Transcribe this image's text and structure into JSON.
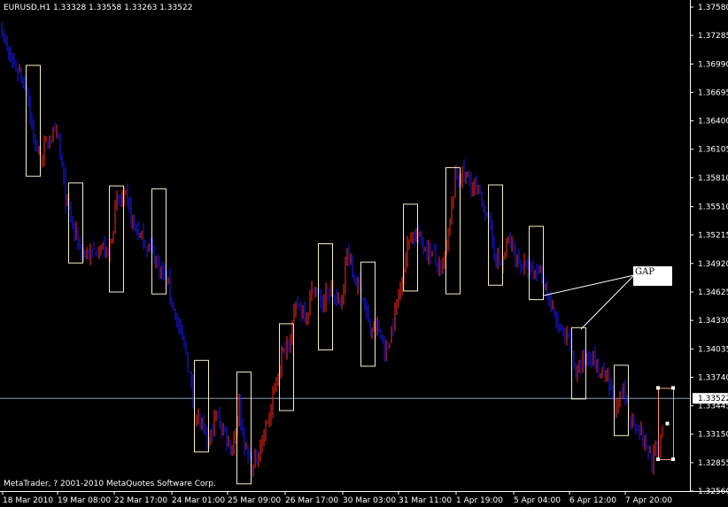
{
  "chart_data": {
    "type": "candlestick",
    "symbol_info": "EURUSD,H1  1.33328 1.33558 1.33263 1.33522",
    "symbol": "EURUSD",
    "timeframe": "H1",
    "last_bar": {
      "open": 1.33328,
      "high": 1.33558,
      "low": 1.33263,
      "close": 1.33522
    },
    "current_price": 1.33522,
    "current_price_label": "1.33522",
    "ylim": [
      1.3256,
      1.3758
    ],
    "y_ticks": [
      1.3758,
      1.37285,
      1.3699,
      1.36695,
      1.364,
      1.36105,
      1.3581,
      1.3551,
      1.35215,
      1.3492,
      1.34625,
      1.3433,
      1.34035,
      1.3374,
      1.33445,
      1.3315,
      1.32855,
      1.3256
    ],
    "y_tick_labels": [
      "1.37580",
      "1.37285",
      "1.36990",
      "1.36695",
      "1.36400",
      "1.36105",
      "1.35810",
      "1.35510",
      "1.35215",
      "1.34920",
      "1.34625",
      "1.34330",
      "1.34035",
      "1.33740",
      "1.33445",
      "1.33150",
      "1.32855",
      "1.32560"
    ],
    "x_tick_labels": [
      "18 Mar 2010",
      "19 Mar 08:00",
      "22 Mar 17:00",
      "24 Mar 01:00",
      "25 Mar 09:00",
      "26 Mar 17:00",
      "30 Mar 03:00",
      "31 Mar 11:00",
      "1 Apr 19:00",
      "5 Apr 04:00",
      "6 Apr 12:00",
      "7 Apr 20:00"
    ],
    "path": [
      [
        0,
        1.3745
      ],
      [
        10,
        1.3705
      ],
      [
        22,
        1.369
      ],
      [
        30,
        1.3675
      ],
      [
        38,
        1.362
      ],
      [
        46,
        1.36
      ],
      [
        56,
        1.3625
      ],
      [
        66,
        1.362
      ],
      [
        74,
        1.356
      ],
      [
        84,
        1.3525
      ],
      [
        92,
        1.3505
      ],
      [
        102,
        1.35
      ],
      [
        112,
        1.351
      ],
      [
        122,
        1.35
      ],
      [
        132,
        1.3555
      ],
      [
        142,
        1.356
      ],
      [
        150,
        1.3535
      ],
      [
        158,
        1.352
      ],
      [
        168,
        1.351
      ],
      [
        180,
        1.349
      ],
      [
        190,
        1.347
      ],
      [
        200,
        1.343
      ],
      [
        210,
        1.34
      ],
      [
        220,
        1.334
      ],
      [
        228,
        1.332
      ],
      [
        236,
        1.3305
      ],
      [
        244,
        1.3335
      ],
      [
        252,
        1.332
      ],
      [
        262,
        1.33
      ],
      [
        270,
        1.3345
      ],
      [
        278,
        1.3295
      ],
      [
        286,
        1.328
      ],
      [
        296,
        1.331
      ],
      [
        306,
        1.334
      ],
      [
        316,
        1.339
      ],
      [
        326,
        1.3415
      ],
      [
        336,
        1.345
      ],
      [
        346,
        1.344
      ],
      [
        354,
        1.347
      ],
      [
        364,
        1.345
      ],
      [
        374,
        1.3465
      ],
      [
        384,
        1.3445
      ],
      [
        392,
        1.3505
      ],
      [
        400,
        1.3475
      ],
      [
        408,
        1.3465
      ],
      [
        418,
        1.342
      ],
      [
        426,
        1.3425
      ],
      [
        436,
        1.34
      ],
      [
        446,
        1.344
      ],
      [
        456,
        1.349
      ],
      [
        464,
        1.3525
      ],
      [
        472,
        1.352
      ],
      [
        480,
        1.351
      ],
      [
        490,
        1.35
      ],
      [
        498,
        1.348
      ],
      [
        506,
        1.352
      ],
      [
        514,
        1.358
      ],
      [
        522,
        1.3585
      ],
      [
        532,
        1.3575
      ],
      [
        542,
        1.356
      ],
      [
        550,
        1.3545
      ],
      [
        558,
        1.3505
      ],
      [
        566,
        1.349
      ],
      [
        574,
        1.3515
      ],
      [
        582,
        1.35
      ],
      [
        590,
        1.349
      ],
      [
        600,
        1.348
      ],
      [
        608,
        1.3485
      ],
      [
        616,
        1.347
      ],
      [
        624,
        1.344
      ],
      [
        634,
        1.342
      ],
      [
        642,
        1.341
      ],
      [
        650,
        1.338
      ],
      [
        658,
        1.339
      ],
      [
        666,
        1.34
      ],
      [
        676,
        1.338
      ],
      [
        686,
        1.337
      ],
      [
        696,
        1.334
      ],
      [
        704,
        1.336
      ],
      [
        712,
        1.333
      ],
      [
        720,
        1.3325
      ],
      [
        728,
        1.3305
      ],
      [
        736,
        1.329
      ],
      [
        744,
        1.33
      ],
      [
        748,
        1.3328
      ]
    ],
    "gap_boxes": [
      [
        29,
        45,
        1.3698,
        1.3583
      ],
      [
        77,
        93,
        1.3576,
        1.3493
      ],
      [
        123,
        139,
        1.3573,
        1.3463
      ],
      [
        171,
        187,
        1.357,
        1.3461
      ],
      [
        219,
        235,
        1.3392,
        1.3297
      ],
      [
        267,
        283,
        1.338,
        1.3264
      ],
      [
        315,
        331,
        1.343,
        1.334
      ],
      [
        359,
        375,
        1.3513,
        1.3403
      ],
      [
        407,
        423,
        1.3494,
        1.3386
      ],
      [
        455,
        471,
        1.3554,
        1.3464
      ],
      [
        503,
        519,
        1.3592,
        1.3461
      ],
      [
        551,
        567,
        1.3574,
        1.347
      ],
      [
        597,
        613,
        1.3531,
        1.3455
      ],
      [
        645,
        661,
        1.3426,
        1.3352
      ],
      [
        693,
        709,
        1.3387,
        1.3314
      ],
      [
        743,
        760,
        1.3363,
        1.3289
      ]
    ],
    "annotation": {
      "text": "GAP"
    },
    "copyright": "MetaTrader, ? 2001-2010 MetaQuotes Software Corp."
  }
}
